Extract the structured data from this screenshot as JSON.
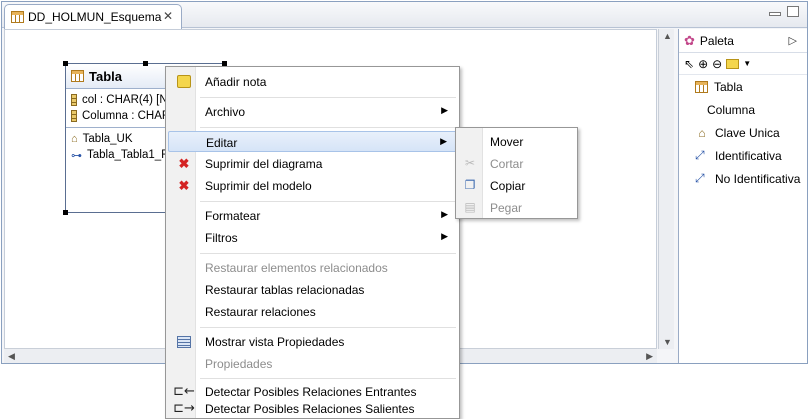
{
  "editor": {
    "tab_title": "DD_HOLMUN_Esquema"
  },
  "table_figure": {
    "title": "Tabla",
    "columns": [
      "col : CHAR(4) [N",
      "Columna : CHAR"
    ],
    "keys": [
      "Tabla_UK",
      "Tabla_Tabla1_F"
    ]
  },
  "palette": {
    "title": "Paleta",
    "items": [
      {
        "label": "Tabla",
        "icon": "table-icon"
      },
      {
        "label": "Columna",
        "icon": "column-icon"
      },
      {
        "label": "Clave Unica",
        "icon": "unique-key-icon"
      },
      {
        "label": "Identificativa",
        "icon": "identifying-relation-icon"
      },
      {
        "label": "No Identificativa",
        "icon": "non-identifying-relation-icon"
      }
    ]
  },
  "context_menu": {
    "items": [
      {
        "label": "Añadir nota",
        "icon": "note-icon",
        "enabled": true
      },
      {
        "label": "Archivo",
        "submenu": true,
        "enabled": true
      },
      {
        "label": "Editar",
        "submenu": true,
        "enabled": true,
        "highlighted": true
      },
      {
        "label": "Suprimir del diagrama",
        "icon": "delete-red-icon",
        "enabled": true
      },
      {
        "label": "Suprimir del modelo",
        "icon": "delete-red-icon",
        "enabled": true
      },
      {
        "label": "Formatear",
        "submenu": true,
        "enabled": true
      },
      {
        "label": "Filtros",
        "submenu": true,
        "enabled": true
      },
      {
        "label": "Restaurar elementos relacionados",
        "enabled": false
      },
      {
        "label": "Restaurar tablas relacionadas",
        "enabled": true
      },
      {
        "label": "Restaurar relaciones",
        "enabled": true
      },
      {
        "label": "Mostrar vista Propiedades",
        "icon": "properties-icon",
        "enabled": true
      },
      {
        "label": "Propiedades",
        "enabled": false
      },
      {
        "label": "Detectar Posibles Relaciones Entrantes",
        "icon": "incoming-relation-icon",
        "enabled": true
      },
      {
        "label": "Detectar Posibles Relaciones Salientes",
        "icon": "outgoing-relation-icon",
        "enabled": true
      }
    ]
  },
  "edit_submenu": {
    "items": [
      {
        "label": "Mover",
        "enabled": true
      },
      {
        "label": "Cortar",
        "icon": "scissors-icon",
        "enabled": false
      },
      {
        "label": "Copiar",
        "icon": "copy-icon",
        "enabled": true
      },
      {
        "label": "Pegar",
        "icon": "paste-icon",
        "enabled": false
      }
    ]
  },
  "colors": {
    "menu_highlight": "#d6e4f7",
    "delete_icon": "#d42323",
    "disabled_text": "#8d8d8d"
  }
}
